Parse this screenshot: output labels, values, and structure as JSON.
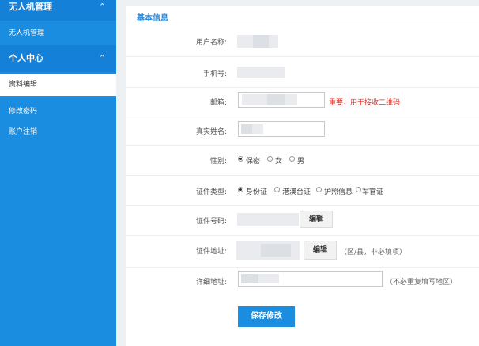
{
  "sidebar": {
    "drone_group": {
      "title": "无人机管理",
      "items": [
        "无人机管理"
      ]
    },
    "user_group": {
      "title": "个人中心",
      "items": [
        "资料编辑",
        "修改密码",
        "账户注销"
      ]
    }
  },
  "main": {
    "title": "基本信息",
    "fields": {
      "username": {
        "label": "用户名称:"
      },
      "phone": {
        "label": "手机号:"
      },
      "email": {
        "label": "邮箱:",
        "note": "重要，用于接收二维码"
      },
      "realname": {
        "label": "真实姓名:"
      },
      "gender": {
        "label": "性别:",
        "options": [
          "保密",
          "女",
          "男"
        ],
        "selected": "保密"
      },
      "id_type": {
        "label": "证件类型:",
        "options": [
          "身份证",
          "港澳台证",
          "护照信息",
          "军官证"
        ],
        "selected": "身份证"
      },
      "id_number": {
        "label": "证件号码:",
        "button": "编辑"
      },
      "id_address": {
        "label": "证件地址:",
        "button": "编辑",
        "hint": "（区/县，非必填项）"
      },
      "detail_address": {
        "label": "详细地址:",
        "hint": "（不必重复填写地区）"
      }
    },
    "save_label": "保存修改"
  },
  "colors": {
    "sidebar": "#1a8de1",
    "accent": "#2a8ae0",
    "warning": "#e0302a"
  }
}
